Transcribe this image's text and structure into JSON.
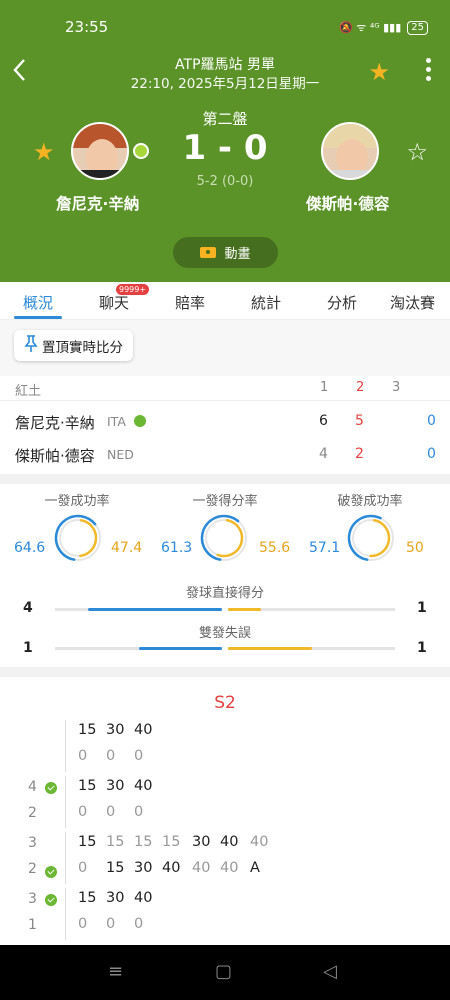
{
  "status_bar": {
    "time": "23:55",
    "icons": "🔕 ᯤ ⁴ᴳ ▮▮▮",
    "battery": "25"
  },
  "header": {
    "league": "ATP羅馬站 男單",
    "datetime": "22:10, 2025年5月12日星期一",
    "set_label": "第二盤",
    "score": "1 - 0",
    "subscore": "5-2 (0-0)",
    "player1": "詹尼克·辛納",
    "player2": "傑斯帕·德容",
    "animation_label": "動畫"
  },
  "tabs": [
    {
      "label": "概況"
    },
    {
      "label": "聊天",
      "badge": "9999+"
    },
    {
      "label": "賠率"
    },
    {
      "label": "統計"
    },
    {
      "label": "分析"
    },
    {
      "label": "淘汰賽"
    }
  ],
  "pin_label": "置頂實時比分",
  "scoreboard": {
    "surface": "紅土",
    "cols": [
      "1",
      "2",
      "3"
    ],
    "rows": [
      {
        "name": "詹尼克·辛納",
        "country": "ITA",
        "s1": "6",
        "s2": "5",
        "s3": "",
        "pts": "0"
      },
      {
        "name": "傑斯帕·德容",
        "country": "NED",
        "s1": "4",
        "s2": "2",
        "s3": "",
        "pts": "0"
      }
    ]
  },
  "stats": {
    "rings": [
      {
        "title": "一發成功率",
        "left": "64.6",
        "right": "47.4",
        "left_frac": 0.646,
        "right_frac": 0.474
      },
      {
        "title": "一發得分率",
        "left": "61.3",
        "right": "55.6",
        "left_frac": 0.613,
        "right_frac": 0.556
      },
      {
        "title": "破發成功率",
        "left": "57.1",
        "right": "50",
        "left_frac": 0.571,
        "right_frac": 0.5
      }
    ],
    "bars": [
      {
        "title": "發球直接得分",
        "left": "4",
        "right": "1",
        "left_frac": 0.8,
        "right_frac": 0.2
      },
      {
        "title": "雙發失誤",
        "left": "1",
        "right": "1",
        "left_frac": 0.5,
        "right_frac": 0.5
      }
    ]
  },
  "pbp": {
    "set": "S2",
    "games": [
      {
        "top": [
          "15",
          "30",
          "40"
        ],
        "bottom": [
          "0",
          "0",
          "0"
        ],
        "s_top": "",
        "s_bot": ""
      },
      {
        "top": [
          "15",
          "30",
          "40"
        ],
        "bottom": [
          "0",
          "0",
          "0"
        ],
        "s_top": "4",
        "s_bot": "2"
      },
      {
        "top": [
          "15",
          "15",
          "15",
          "15",
          "30",
          "40",
          "40"
        ],
        "bottom": [
          "0",
          "15",
          "30",
          "40",
          "40",
          "40",
          "A"
        ],
        "s_top": "3",
        "s_bot": "2"
      },
      {
        "top": [
          "15",
          "30",
          "40"
        ],
        "bottom": [
          "0",
          "0",
          "0"
        ],
        "s_top": "3",
        "s_bot": "1"
      }
    ]
  },
  "nav": {
    "menu": "≡",
    "home": "▢",
    "back": "◁"
  }
}
